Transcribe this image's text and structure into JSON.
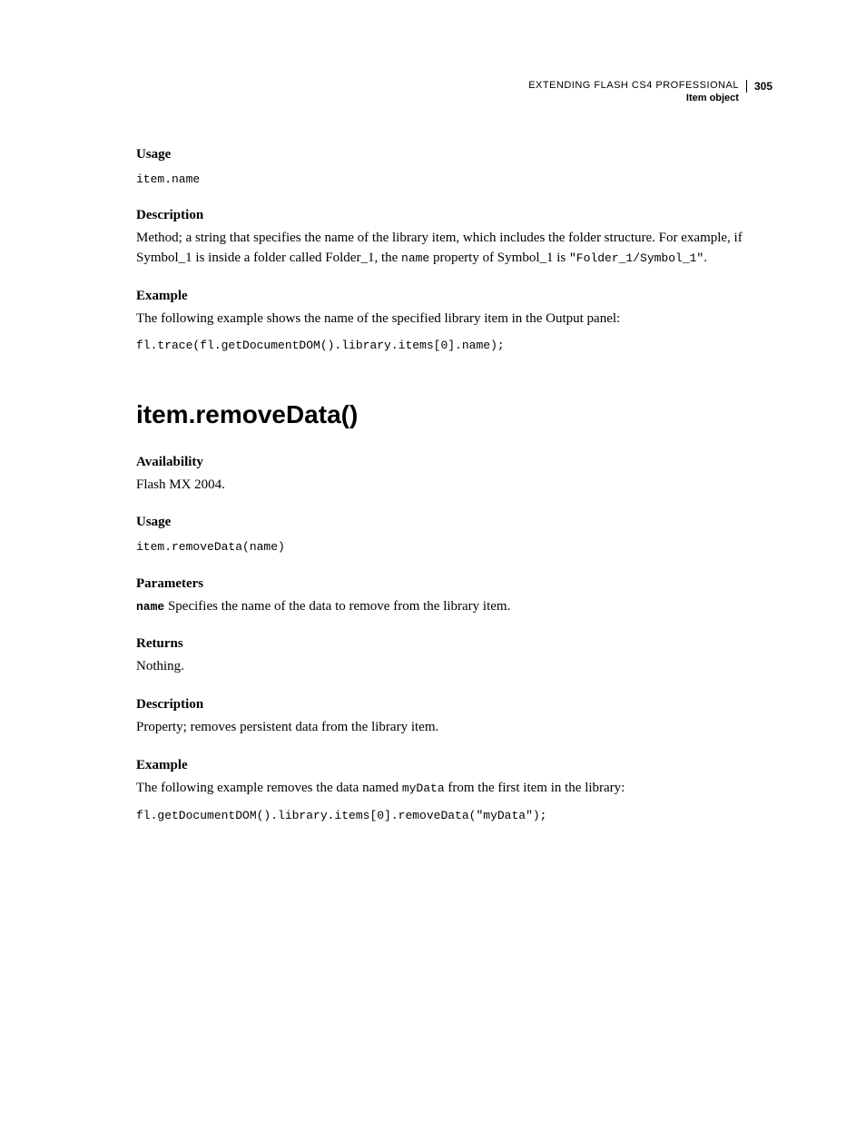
{
  "header": {
    "title": "EXTENDING FLASH CS4 PROFESSIONAL",
    "subtitle": "Item object",
    "page_number": "305"
  },
  "section1": {
    "usage_label": "Usage",
    "usage_code": "item.name",
    "description_label": "Description",
    "description_text_1": "Method; a string that specifies the name of the library item, which includes the folder structure. For example, if Symbol_1 is inside a folder called Folder_1, the ",
    "description_code_1": "name",
    "description_text_2": " property of Symbol_1 is ",
    "description_code_2": "\"Folder_1/Symbol_1\"",
    "description_text_3": ".",
    "example_label": "Example",
    "example_text": "The following example shows the name of the specified library item in the Output panel:",
    "example_code": "fl.trace(fl.getDocumentDOM().library.items[0].name);"
  },
  "method_heading": "item.removeData()",
  "section2": {
    "availability_label": "Availability",
    "availability_text": "Flash MX 2004.",
    "usage_label": "Usage",
    "usage_code": "item.removeData(name)",
    "parameters_label": "Parameters",
    "param_name": "name",
    "param_text": "  Specifies the name of the data to remove from the library item.",
    "returns_label": "Returns",
    "returns_text": "Nothing.",
    "description_label": "Description",
    "description_text": "Property; removes persistent data from the library item.",
    "example_label": "Example",
    "example_text_1": "The following example removes the data named ",
    "example_code_inline": "myData",
    "example_text_2": " from the first item in the library:",
    "example_code": "fl.getDocumentDOM().library.items[0].removeData(\"myData\");"
  }
}
